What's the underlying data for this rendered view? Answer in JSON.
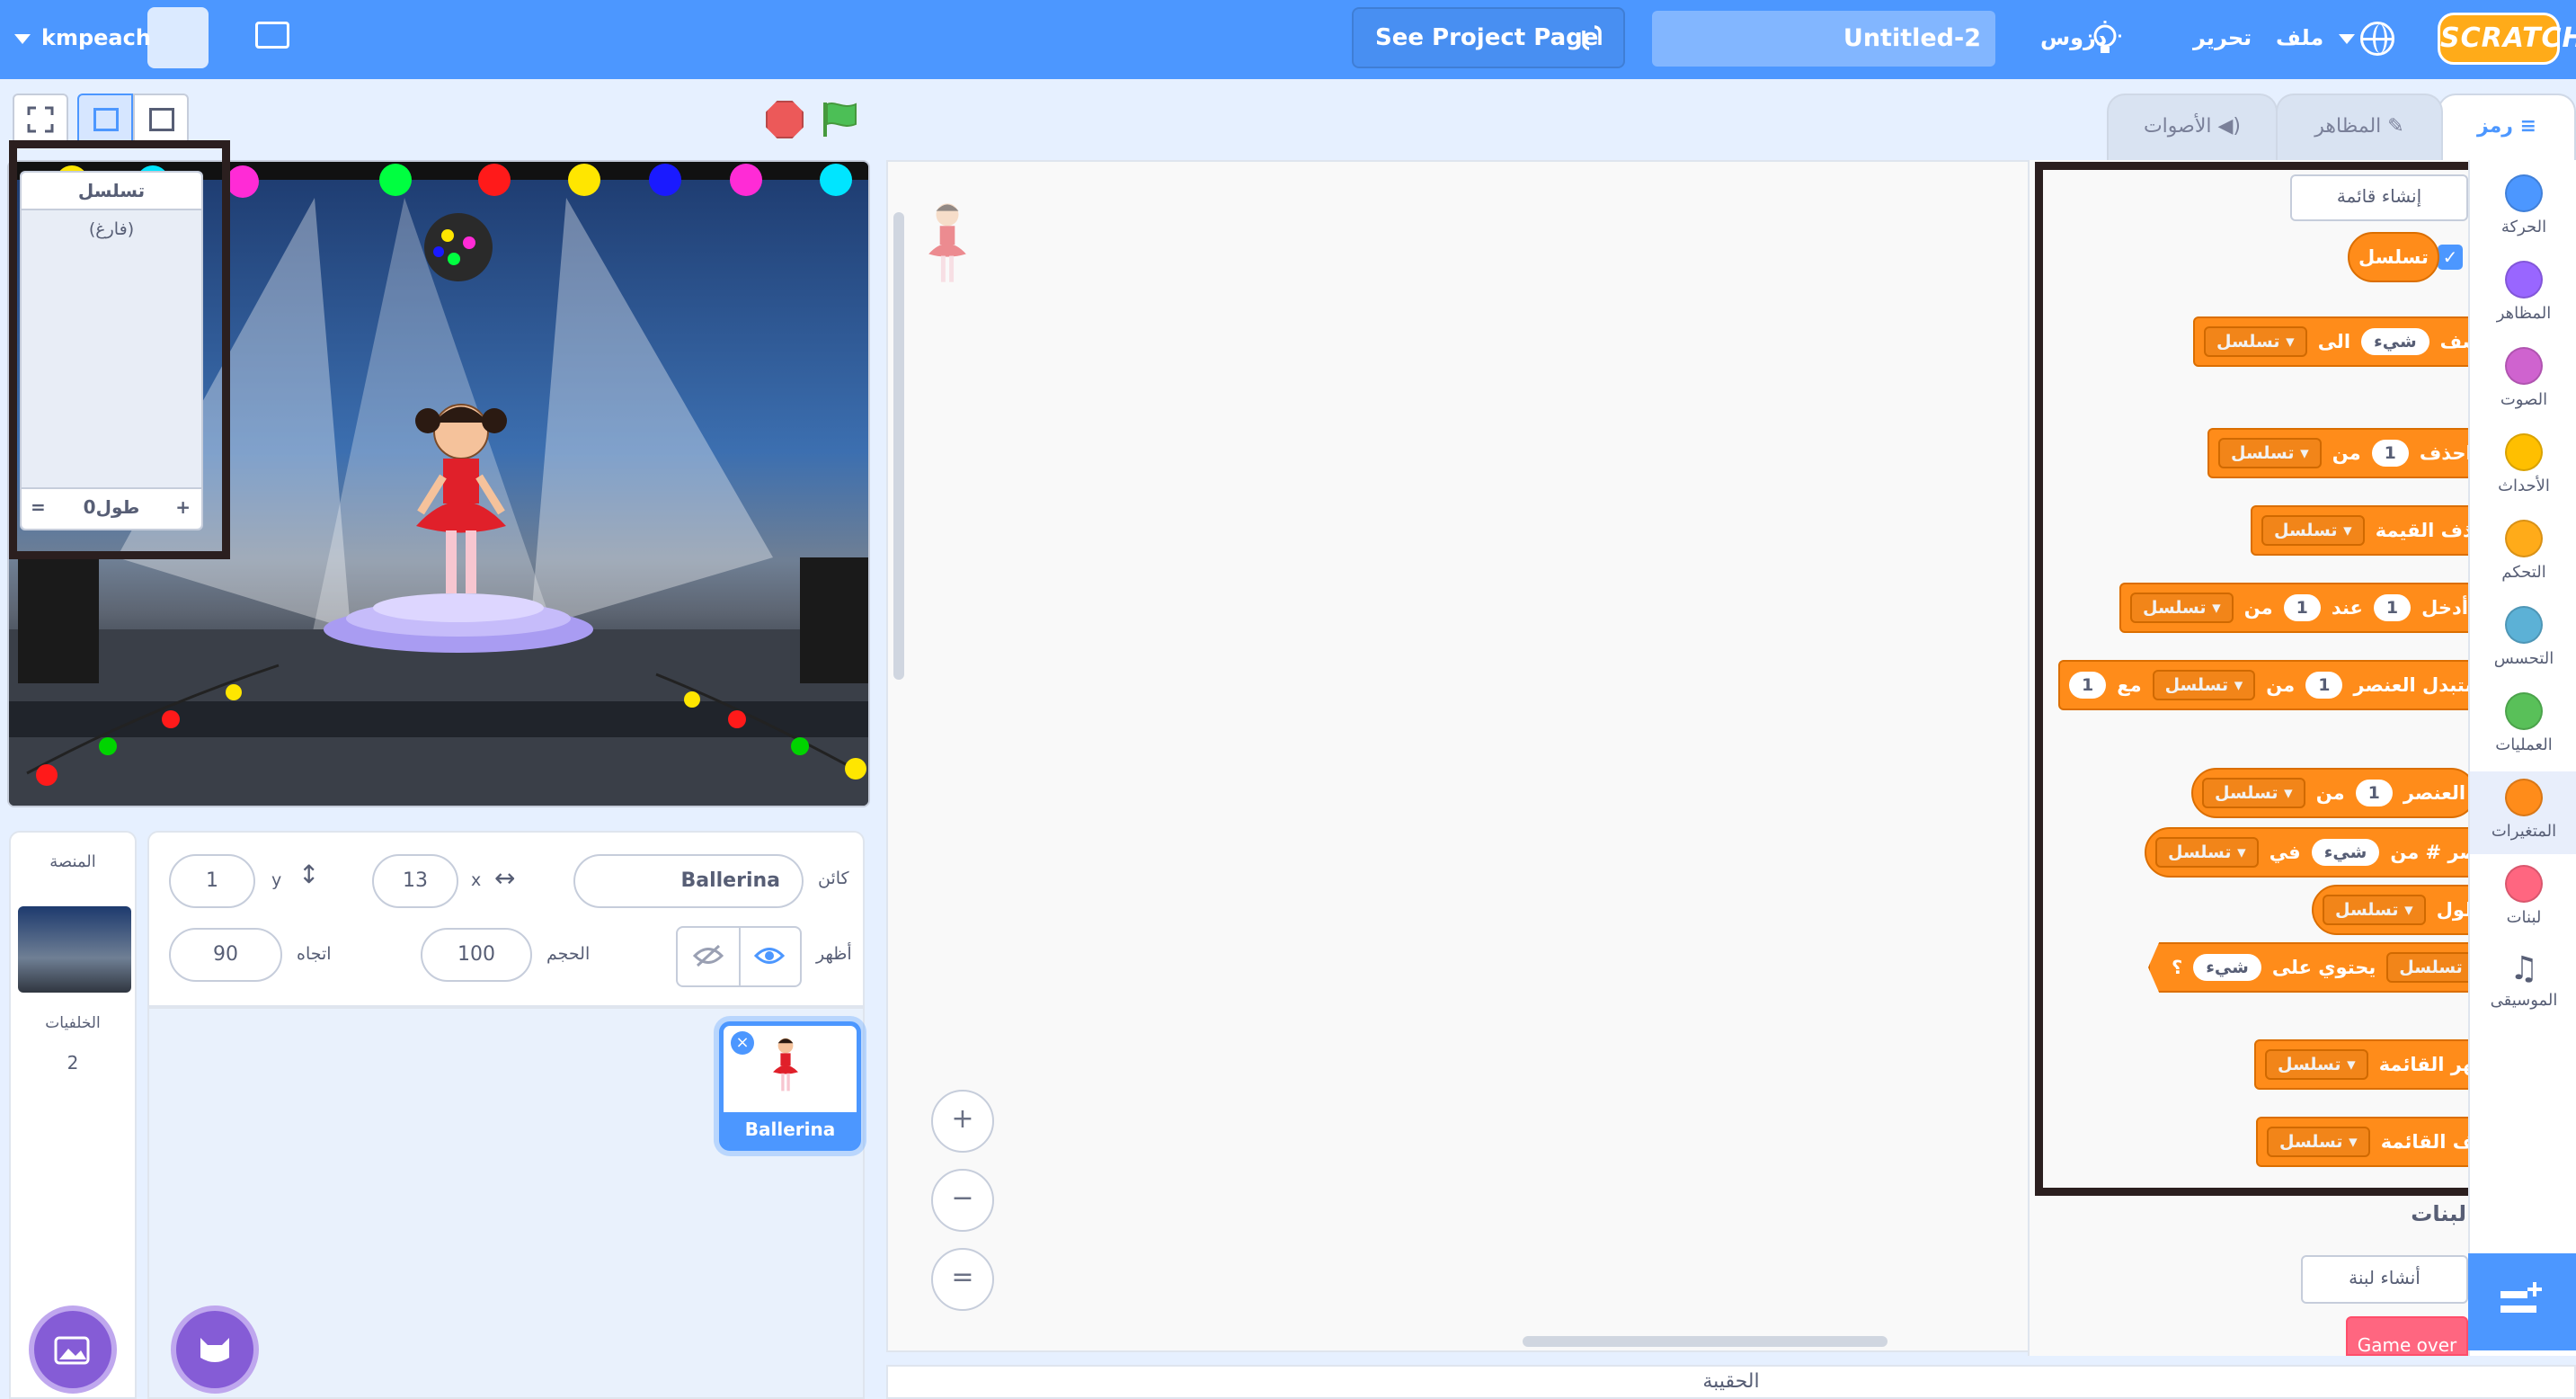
{
  "menu": {
    "username": "kmpeach",
    "see_project": "See Project Page",
    "project_title": "Untitled-2",
    "tutorials": "دروس",
    "edit": "تحرير",
    "file": "ملف",
    "logo_text": "SCRATCH"
  },
  "tabs": {
    "code": "رمز",
    "costumes": "المظاهر",
    "sounds": "الأصوات"
  },
  "categories": [
    {
      "label": "الحركة",
      "color": "#4c97ff"
    },
    {
      "label": "المظاهر",
      "color": "#9966ff"
    },
    {
      "label": "الصوت",
      "color": "#cf63cf"
    },
    {
      "label": "الأحداث",
      "color": "#ffbf00"
    },
    {
      "label": "التحكم",
      "color": "#ffab19"
    },
    {
      "label": "التحسس",
      "color": "#5cb1d6"
    },
    {
      "label": "العمليات",
      "color": "#59c059"
    },
    {
      "label": "المتغيرات",
      "color": "#ff8c1a"
    },
    {
      "label": "لبنات",
      "color": "#ff6680"
    },
    {
      "label": "الموسيقى",
      "color": "#0fbd8c"
    }
  ],
  "palette": {
    "make_list": "إنشاء قائمة",
    "list_name": "تسلسل",
    "blocks": {
      "add": {
        "a": "أضف",
        "val": "شيء",
        "b": "الى",
        "list": "تسلسل"
      },
      "delete": {
        "a": "احذف",
        "val": "1",
        "b": "من",
        "list": "تسلسل"
      },
      "delete_all": {
        "a": "احذف القيمة",
        "list": "تسلسل"
      },
      "insert": {
        "a": "أدخل",
        "val": "1",
        "b": "عند",
        "val2": "1",
        "c": "من",
        "list": "تسلسل"
      },
      "replace": {
        "a": "استبدل العنصر",
        "val": "1",
        "b": "من",
        "list": "تسلسل",
        "c": "مع",
        "val2": "1"
      },
      "item": {
        "a": "العنصر",
        "val": "1",
        "b": "من",
        "list": "تسلسل"
      },
      "item_num": {
        "a": "عنصر # من",
        "val": "شيء",
        "b": "في",
        "list": "تسلسل"
      },
      "length": {
        "a": "طول",
        "list": "تسلسل"
      },
      "contains": {
        "list": "تسلسل",
        "a": "يحتوي على",
        "val": "شيء",
        "q": "؟"
      },
      "show_list": {
        "a": "اظهر القائمة",
        "list": "تسلسل"
      },
      "hide_list": {
        "a": "اخف القائمة",
        "list": "تسلسل"
      }
    },
    "my_blocks_heading": "لبنات",
    "make_block": "أنشاء لبنة",
    "cut_block": "Game over"
  },
  "monitor": {
    "title": "تسلسل",
    "empty": "(فارغ)",
    "plus": "+",
    "length": "طول0",
    "equals": "="
  },
  "sprite_info": {
    "sprite_label": "كائن",
    "sprite_name": "Ballerina",
    "x_label": "x",
    "x": "13",
    "y_label": "y",
    "y": "1",
    "show_label": "أظهر",
    "size_label": "الحجم",
    "size": "100",
    "direction_label": "اتجاه",
    "direction": "90"
  },
  "sprites": [
    {
      "name": "Ballerina"
    }
  ],
  "stage_pane": {
    "title": "المنصة",
    "backdrops_label": "الخلفيات",
    "backdrops_count": "2"
  },
  "backpack": "الحقيبة",
  "zoom": {
    "in": "+",
    "out": "−",
    "reset": "="
  }
}
